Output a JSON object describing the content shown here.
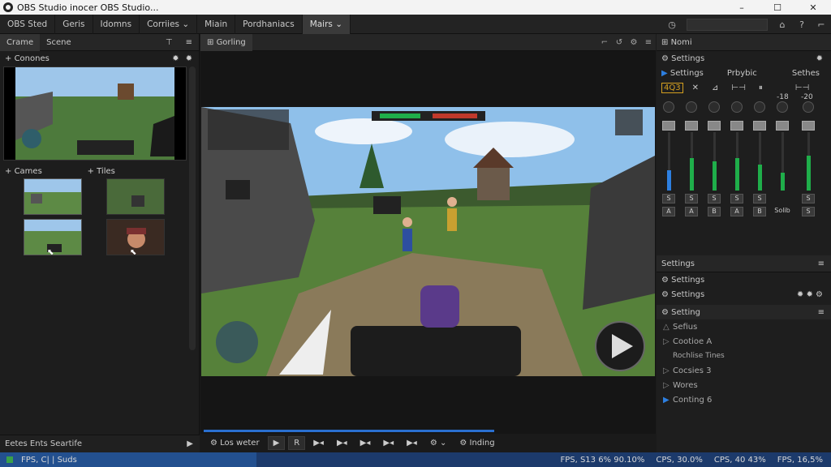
{
  "window": {
    "title": "OBS Studio inocer OBS Studio...",
    "min": "–",
    "max": "☐",
    "close": "✕"
  },
  "menu": {
    "items": [
      "OBS Sted",
      "Geris",
      "Idomns",
      "Corriies ⌄",
      "Miain",
      "Pordhaniacs",
      "Mairs ⌄"
    ],
    "active_index": 6
  },
  "left": {
    "tabs": [
      "Crame",
      "Scene"
    ],
    "sources_label": "Conones",
    "cams_label": "Cames",
    "tiles_label": "Tiles",
    "footer": "Eetes Ents Seartife"
  },
  "center": {
    "tab": "Gorling",
    "controls": {
      "label": "Los weter",
      "play": "▶",
      "rec": "R",
      "btns": [
        "▶◂",
        "▶◂",
        "▶◂",
        "▶◂",
        "▶◂"
      ],
      "gear": "⚙ ⌄",
      "status": "Inding"
    }
  },
  "right": {
    "head": "Nomi",
    "settings_label": "Settings",
    "sub": {
      "a": "Settings",
      "b": "Prbybic",
      "c": "Sethes"
    },
    "tools": [
      "4Q3",
      "✕",
      "⊿",
      "⊢⊣",
      "⏸",
      "⊢⊣"
    ],
    "mixer": {
      "db_labels": [
        "-18",
        "-20"
      ],
      "channels": [
        {
          "s": "S",
          "l": "A",
          "level": 0.35,
          "color": "#2d7fe0"
        },
        {
          "s": "S",
          "l": "A",
          "level": 0.55,
          "color": "#1fae4a"
        },
        {
          "s": "S",
          "l": "B",
          "level": 0.5,
          "color": "#1fae4a"
        },
        {
          "s": "S",
          "l": "A",
          "level": 0.55,
          "color": "#1fae4a"
        },
        {
          "s": "S",
          "l": "B",
          "level": 0.45,
          "color": "#1fae4a"
        },
        {
          "s": "",
          "l": "Solib",
          "level": 0.3,
          "color": "#1fae4a"
        },
        {
          "s": "S",
          "l": "S",
          "level": 0.6,
          "color": "#1fae4a"
        }
      ]
    },
    "settings2": "Settings",
    "rows": [
      "Settings",
      "Settings",
      "Setting"
    ],
    "list": [
      "Sefius",
      "Cootioe A",
      "Rochlise Tines",
      "Cocsies 3",
      "Wores",
      "Conting 6"
    ],
    "list_active": 5
  },
  "status": {
    "left": "FPS, C| | Suds",
    "right": [
      "FPS, S13 6% 90.10%",
      "CPS, 30.0%",
      "CPS, 40 43%",
      "FPS, 16,5%"
    ]
  }
}
